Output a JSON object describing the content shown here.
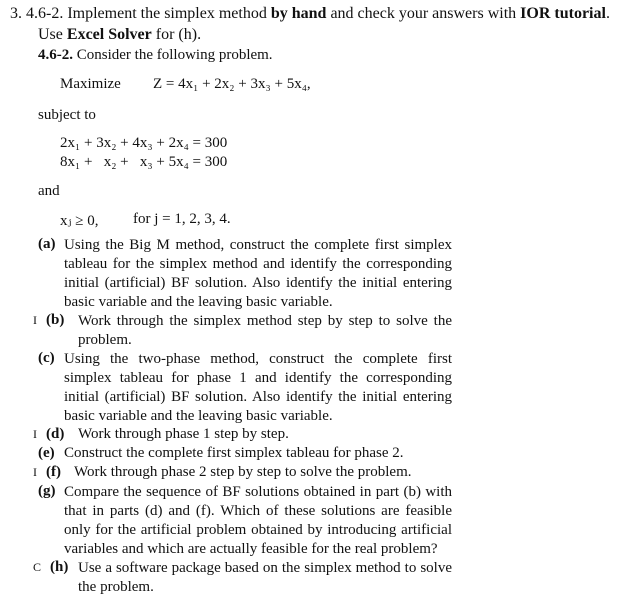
{
  "header": {
    "number": "3.",
    "line1_a": "4.6-2. Implement the simplex method ",
    "line1_b": "by hand",
    "line1_c": " and check your answers with ",
    "line1_d": "IOR tutorial",
    "line1_e": ".",
    "line2_a": "Use ",
    "line2_b": "Excel Solver",
    "line2_c": " for (h)."
  },
  "problem": {
    "id": "4.6-2.",
    "intro": " Consider the following problem.",
    "maximize_label": "Maximize",
    "objective": "Z = 4x₁ + 2x₂ + 3x₃ + 5x₄,",
    "subject_to": "subject to",
    "constraints": [
      "2x₁ + 3x₂ + 4x₃ + 2x₄ = 300",
      "8x₁ +   x₂ +   x₃ + 5x₄ = 300"
    ],
    "and_label": "and",
    "nonneg": "xⱼ ≥ 0,",
    "nonneg_range": "for j = 1, 2, 3, 4."
  },
  "parts": [
    {
      "mark": "",
      "label": "(a)",
      "text": "Using the Big M method, construct the complete first simplex tableau for the simplex method and identify the corresponding initial (artificial) BF solution. Also identify the initial entering basic variable and the leaving basic variable."
    },
    {
      "mark": "I",
      "label": "(b)",
      "text": "Work through the simplex method step by step to solve the problem."
    },
    {
      "mark": "",
      "label": "(c)",
      "text": "Using the two-phase method, construct the complete first simplex tableau for phase 1 and identify the corresponding initial (artificial) BF solution. Also identify the initial entering basic variable and the leaving basic variable."
    },
    {
      "mark": "I",
      "label": "(d)",
      "text": "Work through phase 1 step by step."
    },
    {
      "mark": "",
      "label": "(e)",
      "text": "Construct the complete first simplex tableau for phase 2."
    },
    {
      "mark": "I",
      "label": "(f)",
      "text": "Work through phase 2 step by step to solve the problem."
    },
    {
      "mark": "",
      "label": "(g)",
      "text": "Compare the sequence of BF solutions obtained in part (b) with that in parts (d) and (f). Which of these solutions are feasible only for the artificial problem obtained by introducing artificial variables and which are actually feasible for the real problem?"
    },
    {
      "mark": "C",
      "label": "(h)",
      "text": "Use a software package based on the simplex method to solve the problem."
    }
  ]
}
